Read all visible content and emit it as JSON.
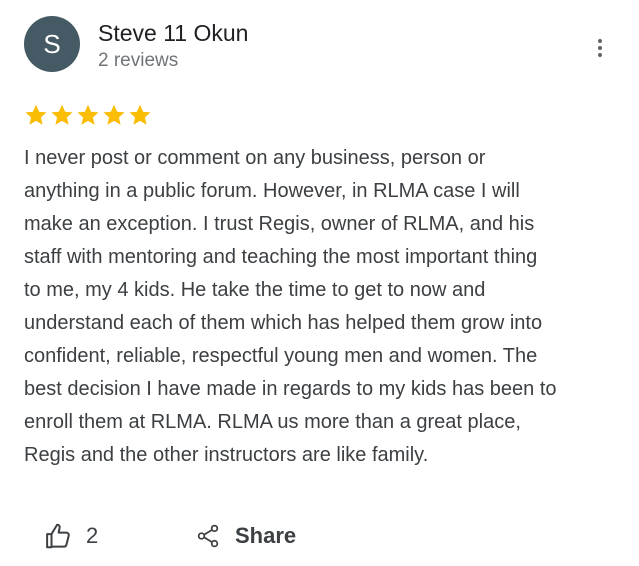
{
  "review": {
    "avatar_initial": "S",
    "author_name": "Steve 11 Okun",
    "review_count": "2 reviews",
    "rating": 5,
    "text": "I never post or comment on any business,  person or\nanything in a public forum.  However, in RLMA case I will\nmake an exception.  I trust  Regis, owner of RLMA, and his\nstaff with mentoring and teaching the most important thing\nto me, my 4 kids.  He take the time to get to now and\nunderstand each of them which has helped them grow into\nconfident,  reliable, respectful young men and women.  The\nbest decision I have made in regards to my kids has been to\nenroll them at RLMA.  RLMA us more than a great place,\nRegis and the other instructors are like family."
  },
  "actions": {
    "like_count": "2",
    "share_label": "Share"
  },
  "icons": {
    "more": "more-vert-icon",
    "star": "star-icon",
    "like": "thumb-up-icon",
    "share": "share-icon"
  },
  "colors": {
    "avatar_bg": "#455a64",
    "star": "#fbbc04",
    "text": "#3c4043",
    "muted": "#70757a"
  }
}
